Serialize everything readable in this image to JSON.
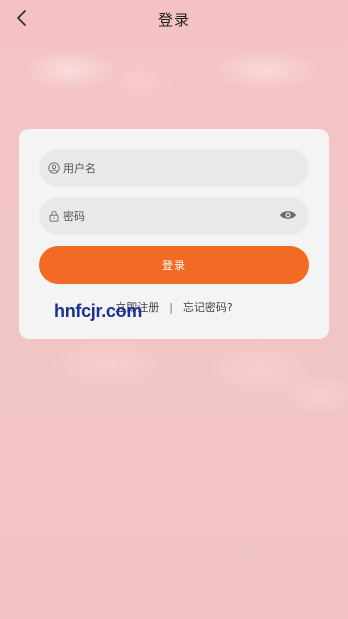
{
  "header": {
    "title": "登录",
    "back_icon": "chevron-left-icon"
  },
  "form": {
    "username_placeholder": "用户名",
    "password_placeholder": "密码",
    "login_label": "登录",
    "register_link": "立即注册",
    "separator": "|",
    "forgot_link": "忘记密码?"
  },
  "watermark": {
    "text": "hnfcjr.com"
  },
  "colors": {
    "accent": "#f26a24",
    "background": "#f2c4c6",
    "card": "#f4f4f5",
    "field": "#e9e9ea",
    "watermark": "#1b2f98"
  }
}
